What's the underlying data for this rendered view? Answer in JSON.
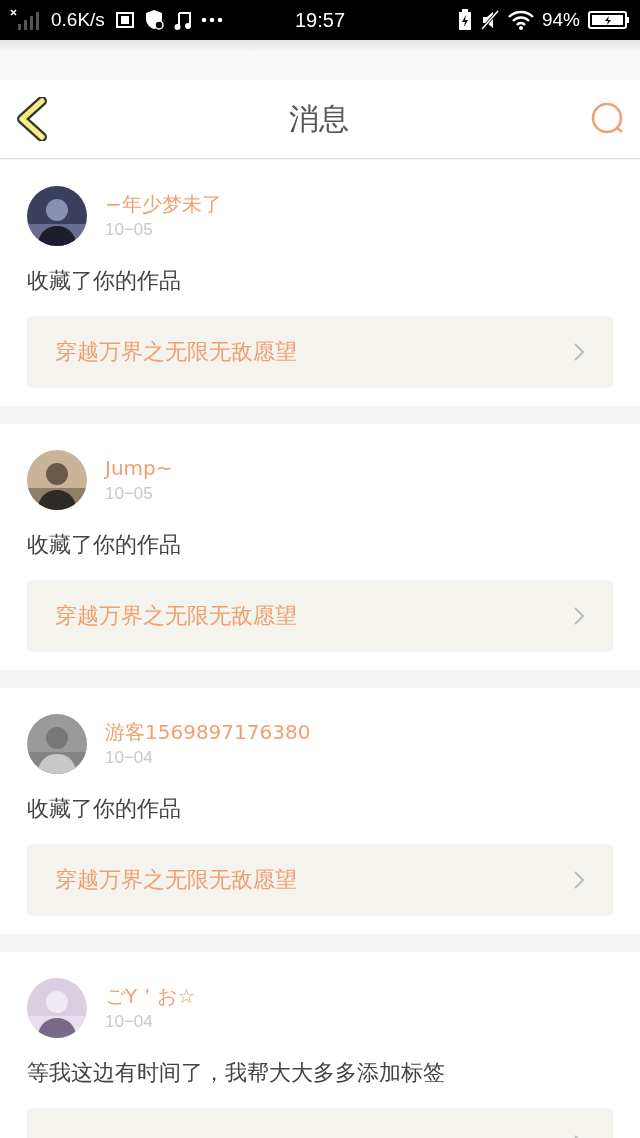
{
  "status_bar": {
    "speed": "0.6K/s",
    "time": "19:57",
    "battery": "94%"
  },
  "header": {
    "title": "消息"
  },
  "messages": [
    {
      "name": "−年少梦未了",
      "date": "10−05",
      "text": "收藏了你的作品",
      "book": "穿越万界之无限无敌愿望"
    },
    {
      "name": "Jump~",
      "date": "10−05",
      "text": "收藏了你的作品",
      "book": "穿越万界之无限无敌愿望"
    },
    {
      "name": "游客1569897176380",
      "date": "10−04",
      "text": "收藏了你的作品",
      "book": "穿越万界之无限无敌愿望"
    },
    {
      "name": "ごY＇お☆",
      "date": "10−04",
      "text": "等我这边有时间了，我帮大大多多添加标签"
    }
  ]
}
